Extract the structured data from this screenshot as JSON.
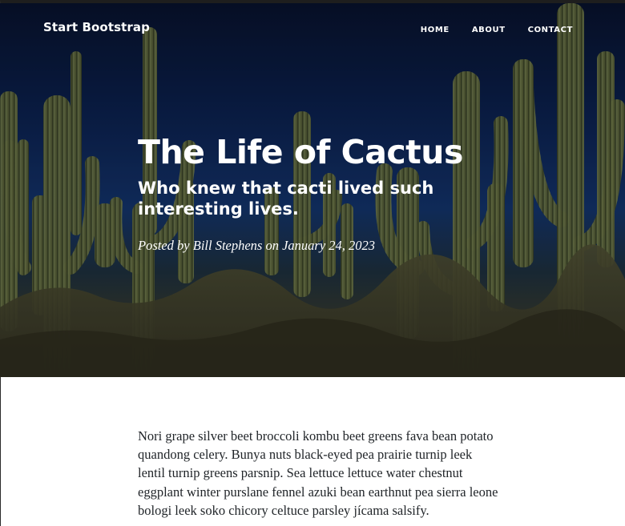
{
  "nav": {
    "brand": "Start Bootstrap",
    "links": [
      "HOME",
      "ABOUT",
      "CONTACT"
    ]
  },
  "post": {
    "title": "The Life of Cactus",
    "subtitle": "Who knew that cacti lived such interesting lives.",
    "meta_prefix": "Posted by",
    "author": "Bill Stephens",
    "meta_on": "on",
    "date": "January 24, 2023"
  },
  "article": {
    "paragraph": "Nori grape silver beet broccoli kombu beet greens fava bean potato quandong celery. Bunya nuts black-eyed pea prairie turnip leek lentil turnip greens parsnip. Sea lettuce lettuce water chestnut eggplant winter purslane fennel azuki bean earthnut pea sierra leone bologi leek soko chicory celtuce parsley jícama salsify."
  },
  "colors": {
    "sky": "#0b1f4a",
    "cactus": "#5c6a3a",
    "text_dark": "#212529"
  },
  "hero_image": "saguaro-cactus-desert-photo"
}
